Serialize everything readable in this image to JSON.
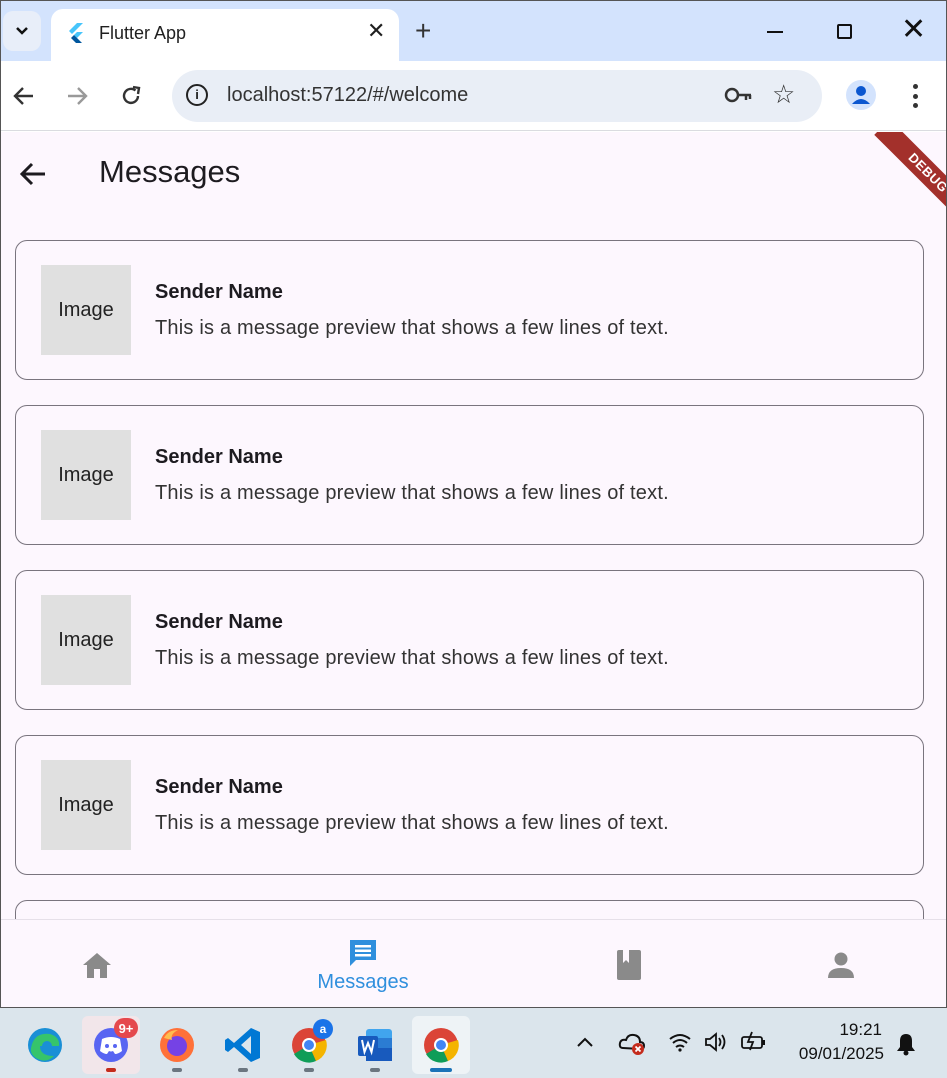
{
  "browser": {
    "tab_title": "Flutter App",
    "url": "localhost:57122/#/welcome"
  },
  "app": {
    "title": "Messages",
    "debug_banner": "DEBUG",
    "messages": [
      {
        "thumb": "Image",
        "sender": "Sender Name",
        "preview": "This is a message preview that shows a few lines of text."
      },
      {
        "thumb": "Image",
        "sender": "Sender Name",
        "preview": "This is a message preview that shows a few lines of text."
      },
      {
        "thumb": "Image",
        "sender": "Sender Name",
        "preview": "This is a message preview that shows a few lines of text."
      },
      {
        "thumb": "Image",
        "sender": "Sender Name",
        "preview": "This is a message preview that shows a few lines of text."
      }
    ],
    "bottom_nav": {
      "items": [
        {
          "icon": "home-icon",
          "label": ""
        },
        {
          "icon": "message-icon",
          "label": "Messages",
          "selected": true
        },
        {
          "icon": "book-icon",
          "label": ""
        },
        {
          "icon": "person-icon",
          "label": ""
        }
      ],
      "active_color": "#2f8fdd",
      "inactive_color": "#8a8a8a"
    }
  },
  "taskbar": {
    "discord_badge": "9+",
    "chrome_badge": "a",
    "time": "19:21",
    "date": "09/01/2025"
  }
}
